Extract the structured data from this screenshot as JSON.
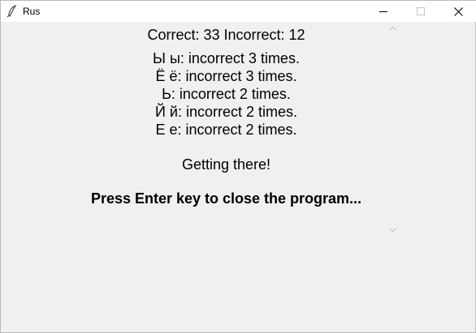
{
  "window": {
    "title": "Rus",
    "app_icon": "feather-icon",
    "controls": [
      "minimize-icon",
      "maximize-icon",
      "close-icon"
    ]
  },
  "results": {
    "score_line": "Correct: 33 Incorrect: 12",
    "missed": [
      "Ы ы: incorrect 3 times.",
      "Ё ё: incorrect 3 times.",
      "Ь: incorrect 2 times.",
      "Й й: incorrect 2 times.",
      "Е е: incorrect 2 times."
    ],
    "message": "Getting there!",
    "prompt": "Press Enter key to close the program..."
  },
  "scrollbar": {
    "up_icon": "chevron-up-icon",
    "down_icon": "chevron-down-icon"
  }
}
